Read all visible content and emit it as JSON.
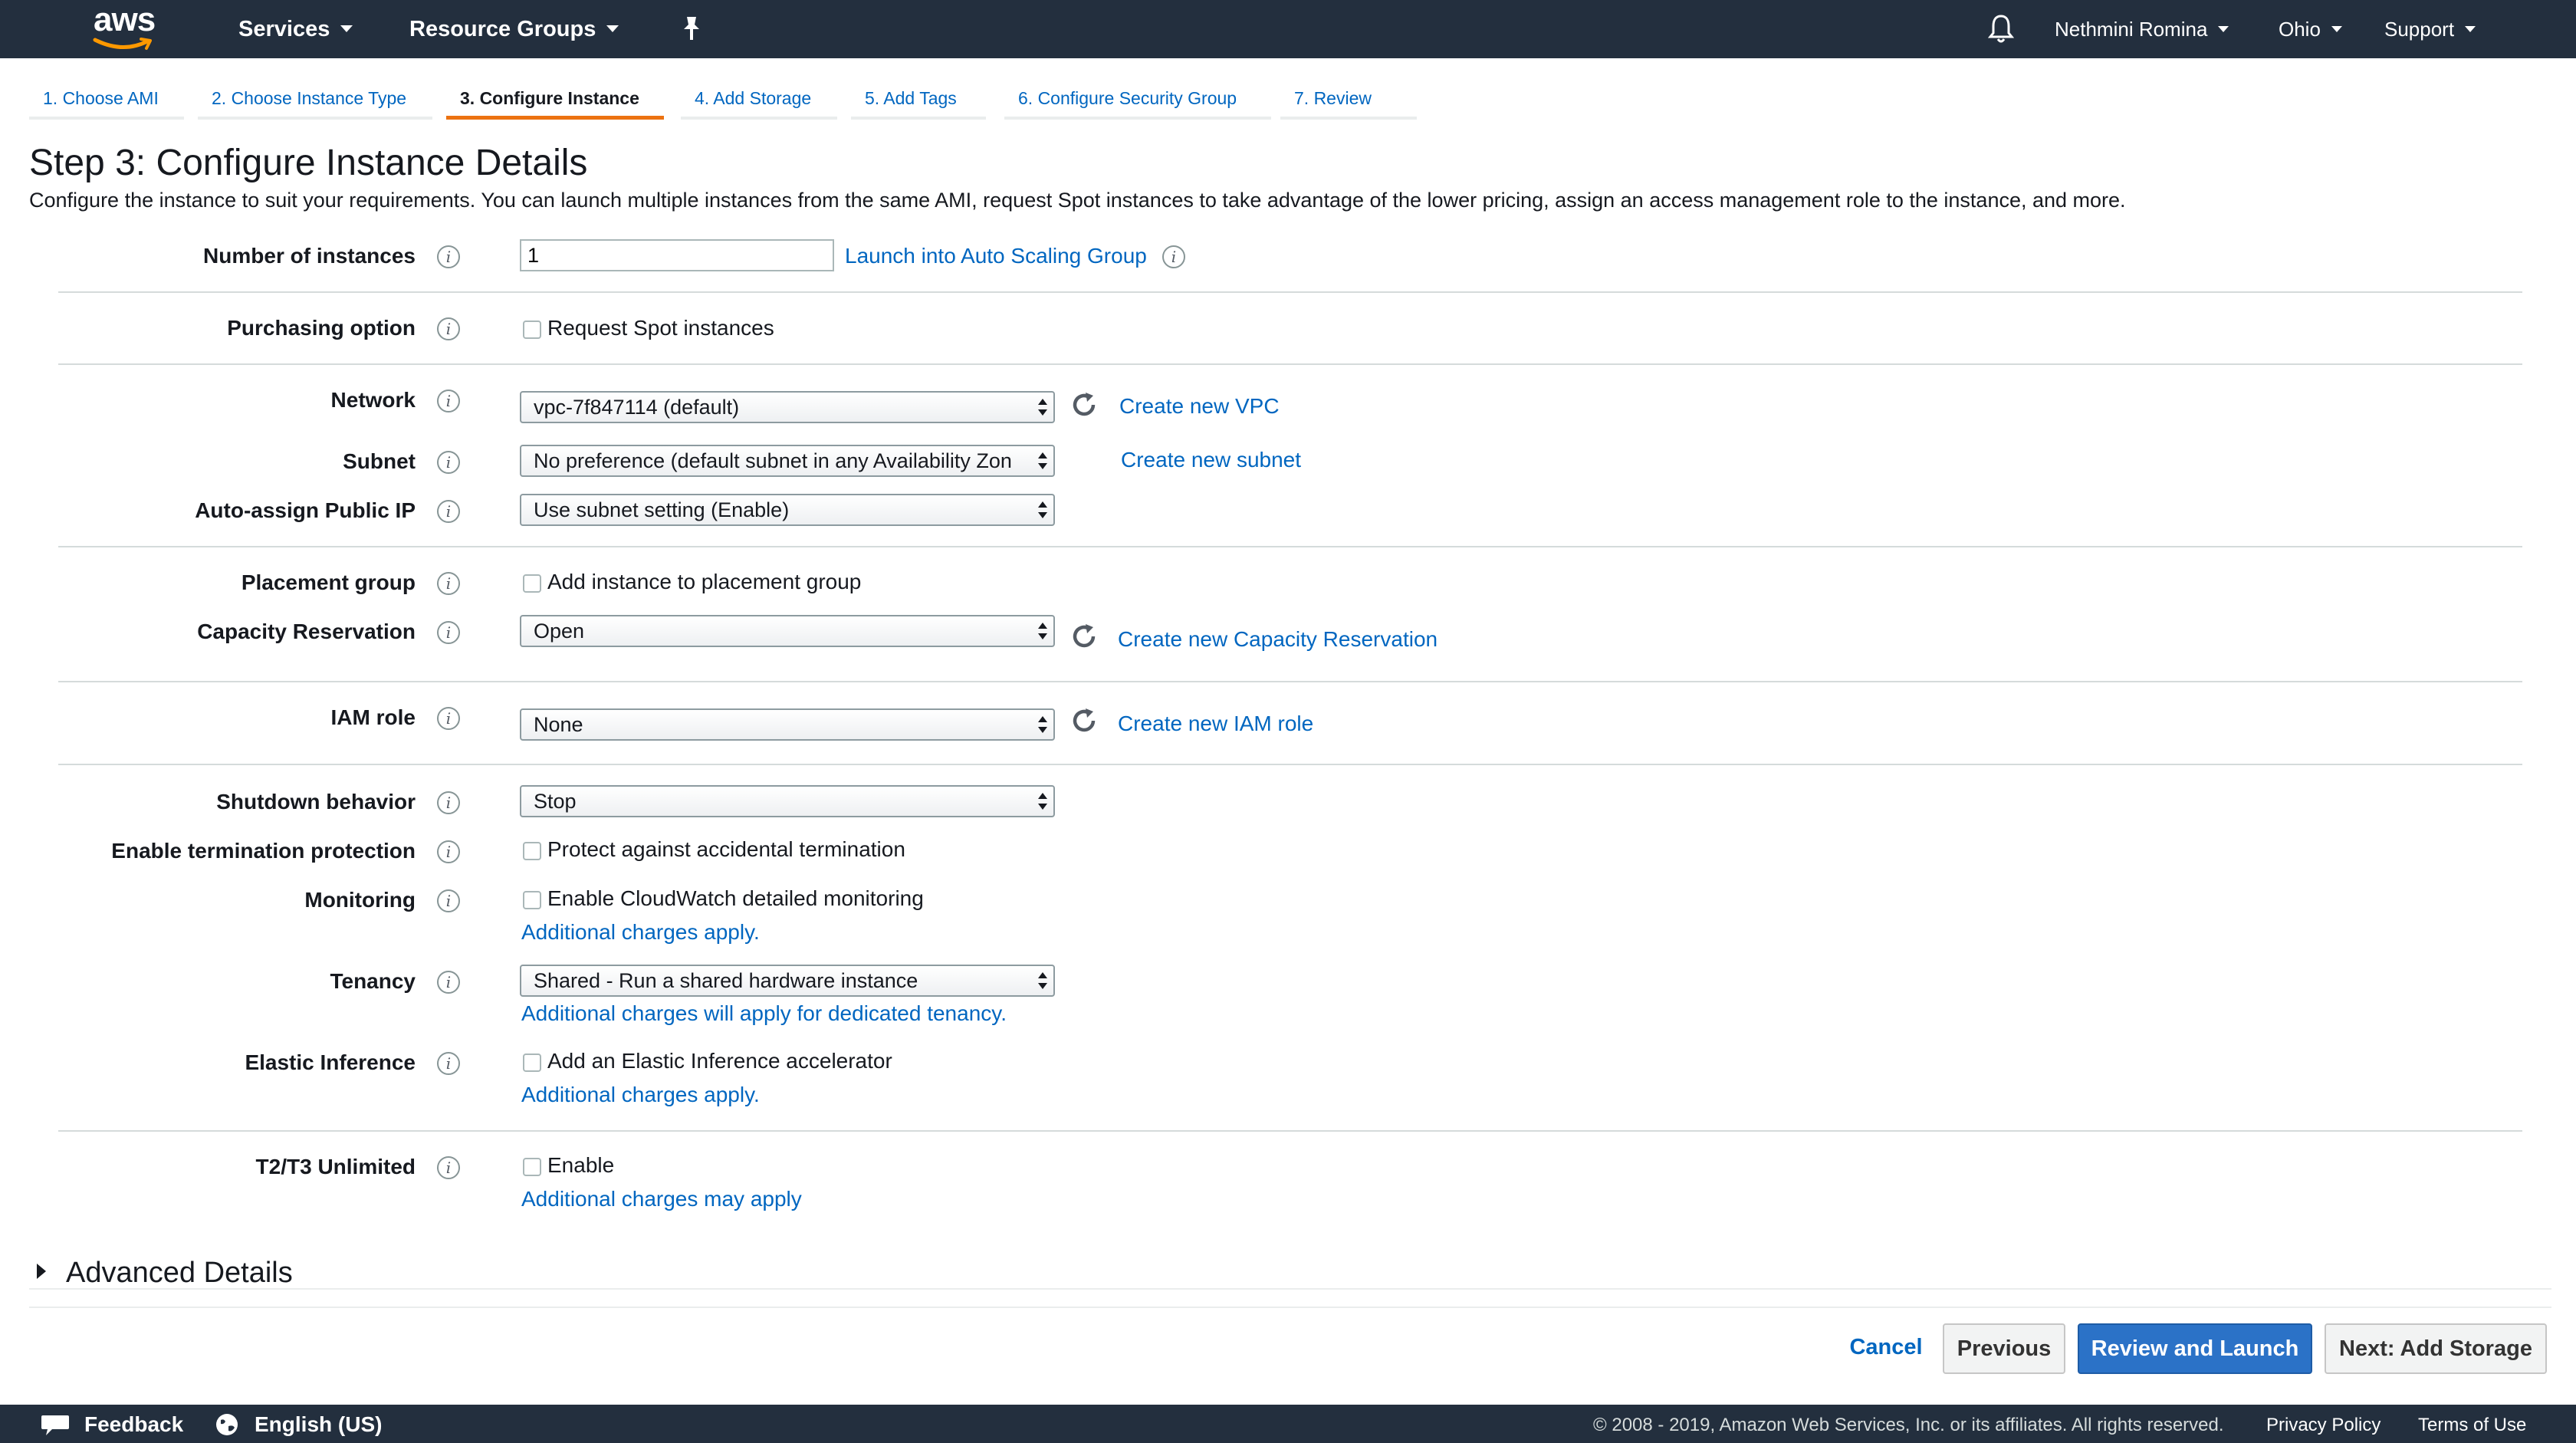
{
  "topbar": {
    "logo_text": "aws",
    "services": "Services",
    "resource_groups": "Resource Groups",
    "user": "Nethmini Romina",
    "region": "Ohio",
    "support": "Support"
  },
  "wizard_tabs": [
    {
      "label": "1. Choose AMI",
      "active": false
    },
    {
      "label": "2. Choose Instance Type",
      "active": false
    },
    {
      "label": "3. Configure Instance",
      "active": true
    },
    {
      "label": "4. Add Storage",
      "active": false
    },
    {
      "label": "5. Add Tags",
      "active": false
    },
    {
      "label": "6. Configure Security Group",
      "active": false
    },
    {
      "label": "7. Review",
      "active": false
    }
  ],
  "page": {
    "title": "Step 3: Configure Instance Details",
    "description": "Configure the instance to suit your requirements. You can launch multiple instances from the same AMI, request Spot instances to take advantage of the lower pricing, assign an access management role to the instance, and more."
  },
  "form": {
    "number_of_instances": {
      "label": "Number of instances",
      "value": "1",
      "link": "Launch into Auto Scaling Group"
    },
    "purchasing_option": {
      "label": "Purchasing option",
      "checkbox": "Request Spot instances"
    },
    "network": {
      "label": "Network",
      "value": "vpc-7f847114 (default)",
      "link": "Create new VPC"
    },
    "subnet": {
      "label": "Subnet",
      "value": "No preference (default subnet in any Availability Zon",
      "link": "Create new subnet"
    },
    "auto_assign_ip": {
      "label": "Auto-assign Public IP",
      "value": "Use subnet setting (Enable)"
    },
    "placement_group": {
      "label": "Placement group",
      "checkbox": "Add instance to placement group"
    },
    "capacity_reservation": {
      "label": "Capacity Reservation",
      "value": "Open",
      "link": "Create new Capacity Reservation"
    },
    "iam_role": {
      "label": "IAM role",
      "value": "None",
      "link": "Create new IAM role"
    },
    "shutdown_behavior": {
      "label": "Shutdown behavior",
      "value": "Stop"
    },
    "termination_protection": {
      "label": "Enable termination protection",
      "checkbox": "Protect against accidental termination"
    },
    "monitoring": {
      "label": "Monitoring",
      "checkbox": "Enable CloudWatch detailed monitoring",
      "link": "Additional charges apply."
    },
    "tenancy": {
      "label": "Tenancy",
      "value": "Shared - Run a shared hardware instance",
      "link": "Additional charges will apply for dedicated tenancy."
    },
    "elastic_inference": {
      "label": "Elastic Inference",
      "checkbox": "Add an Elastic Inference accelerator",
      "link": "Additional charges apply."
    },
    "t2t3_unlimited": {
      "label": "T2/T3 Unlimited",
      "checkbox": "Enable",
      "link": "Additional charges may apply"
    }
  },
  "advanced_details": "Advanced Details",
  "actions": {
    "cancel": "Cancel",
    "previous": "Previous",
    "review_launch": "Review and Launch",
    "next": "Next: Add Storage"
  },
  "footer": {
    "feedback": "Feedback",
    "language": "English (US)",
    "copyright": "© 2008 - 2019, Amazon Web Services, Inc. or its affiliates. All rights reserved.",
    "privacy": "Privacy Policy",
    "terms": "Terms of Use"
  },
  "colors": {
    "nav_bg": "#232f3e",
    "accent_orange": "#ec7211",
    "link_blue": "#0066c0",
    "primary_button": "#2b72c7"
  }
}
